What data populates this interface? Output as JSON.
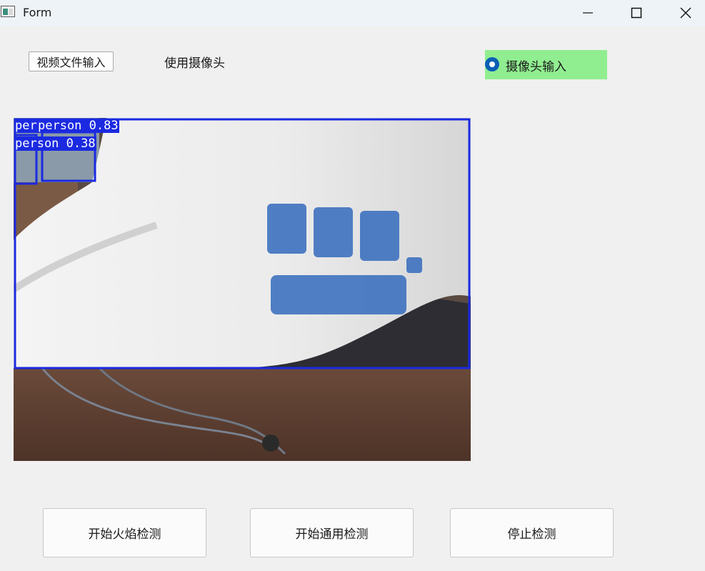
{
  "window": {
    "title": "Form",
    "icon": "app-window-icon",
    "controls": [
      "minimize-icon",
      "maximize-icon",
      "close-icon"
    ]
  },
  "top_controls": {
    "video_file_button": "视频文件输入",
    "use_camera_label": "使用摄像头",
    "camera_radio": {
      "label": "摄像头输入",
      "checked": true,
      "highlight_color": "#90ee90"
    }
  },
  "video_feed": {
    "detection_color": "#1b2ae0",
    "detections": [
      {
        "label": "person 0.83"
      },
      {
        "label": "person 0.38"
      },
      {
        "label": "per"
      }
    ]
  },
  "buttons": {
    "fire_detect": "开始火焰检测",
    "general_detect": "开始通用检测",
    "stop_detect": "停止检测"
  }
}
